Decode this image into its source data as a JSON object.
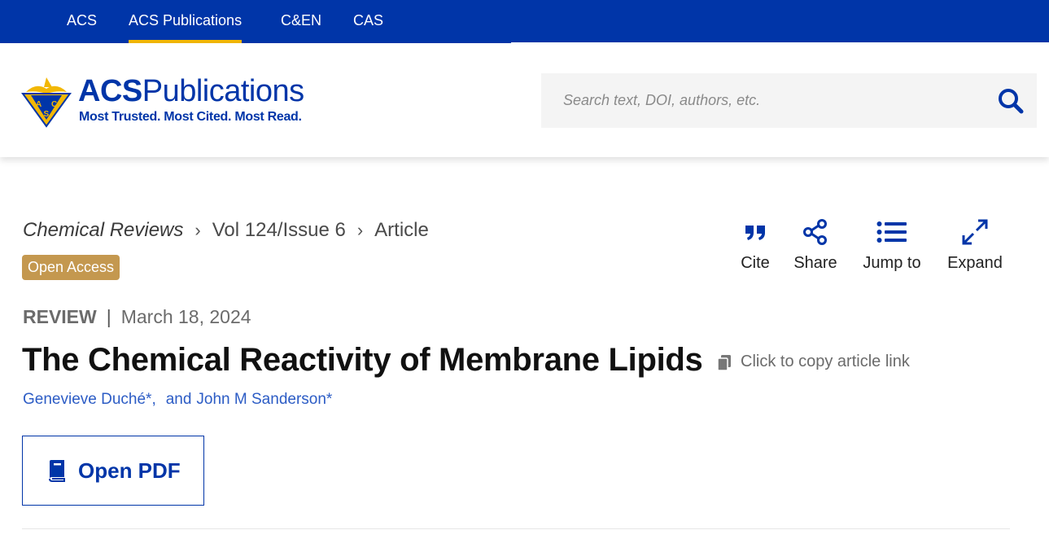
{
  "topnav": {
    "tabs": [
      {
        "label": "ACS",
        "active": false
      },
      {
        "label": "ACS Publications",
        "active": true
      },
      {
        "label": "C&EN",
        "active": false
      },
      {
        "label": "CAS",
        "active": false
      }
    ],
    "accent_color": "#f2b705",
    "background_color": "#0035a8"
  },
  "header": {
    "logo_title_bold": "ACS",
    "logo_title_rest": "Publications",
    "logo_tagline": "Most Trusted. Most Cited. Most Read.",
    "logo_emblem_letters": [
      "A",
      "C",
      "S"
    ],
    "search_placeholder": "Search text, DOI, authors, etc.",
    "search_icon": "search-icon"
  },
  "breadcrumb": {
    "journal": "Chemical Reviews",
    "issue": "Vol 124/Issue 6",
    "current": "Article"
  },
  "badge": {
    "label": "Open Access",
    "color": "#c4984f"
  },
  "tools": [
    {
      "label": "Cite",
      "icon": "quote-icon"
    },
    {
      "label": "Share",
      "icon": "share-icon"
    },
    {
      "label": "Jump to",
      "icon": "list-icon"
    },
    {
      "label": "Expand",
      "icon": "expand-icon"
    }
  ],
  "article": {
    "type": "REVIEW",
    "separator": "|",
    "date": "March 18, 2024",
    "title": "The Chemical Reactivity of Membrane Lipids",
    "copy_link_label": "Click to copy article link",
    "authors": [
      {
        "name": "Genevieve Duché*",
        "suffix": ","
      },
      {
        "name": "John M Sanderson*",
        "suffix": ""
      }
    ],
    "author_conjunction": "and"
  },
  "pdf_button": {
    "label": "Open PDF",
    "icon": "book-icon"
  }
}
